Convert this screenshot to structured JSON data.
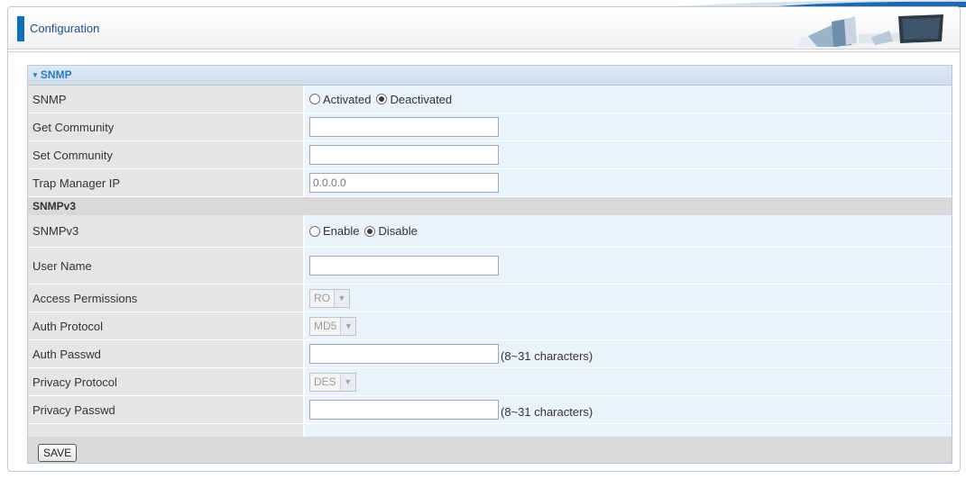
{
  "header": {
    "title": "Configuration"
  },
  "section": {
    "title": "SNMP"
  },
  "snmp": {
    "label": "SNMP",
    "options": [
      "Activated",
      "Deactivated"
    ],
    "selected": "Deactivated"
  },
  "get_community": {
    "label": "Get Community",
    "value": ""
  },
  "set_community": {
    "label": "Set Community",
    "value": ""
  },
  "trap_manager": {
    "label": "Trap Manager IP",
    "placeholder": "0.0.0.0"
  },
  "snmpv3_header": "SNMPv3",
  "snmpv3": {
    "label": "SNMPv3",
    "options": [
      "Enable",
      "Disable"
    ],
    "selected": "Disable"
  },
  "user_name": {
    "label": "User Name",
    "value": ""
  },
  "access_permissions": {
    "label": "Access Permissions",
    "value": "RO"
  },
  "auth_protocol": {
    "label": "Auth Protocol",
    "value": "MD5"
  },
  "auth_passwd": {
    "label": "Auth Passwd",
    "hint": "(8~31 characters)"
  },
  "privacy_protocol": {
    "label": "Privacy Protocol",
    "value": "DES"
  },
  "privacy_passwd": {
    "label": "Privacy Passwd",
    "hint": "(8~31 characters)"
  },
  "save_label": "SAVE",
  "icons": [
    "collapse-triangle-icon",
    "radio-icon",
    "dropdown-arrow-icon",
    "header-banner-art"
  ],
  "colors": {
    "accent": "#0c6fb8",
    "section_title": "#2a7ac0",
    "panel_bg": "#eef3f8"
  }
}
